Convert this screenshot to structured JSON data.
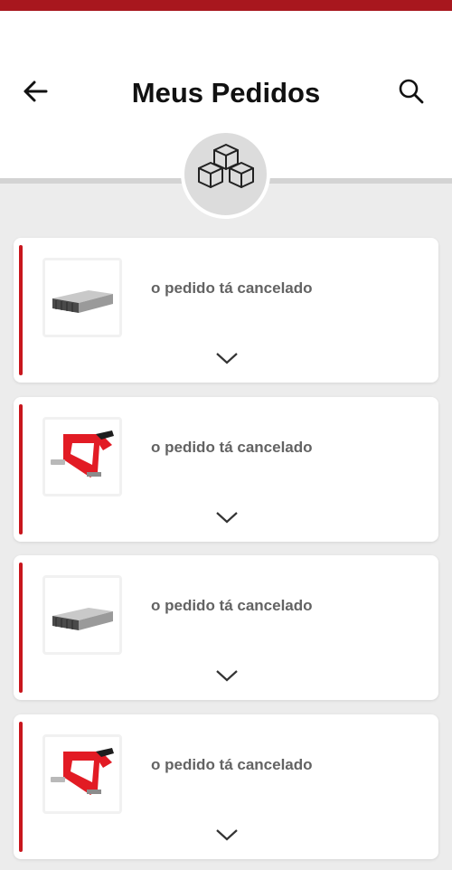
{
  "header": {
    "title": "Meus Pedidos",
    "back_icon": "arrow-left-icon",
    "search_icon": "search-icon",
    "badge_icon": "boxes-icon"
  },
  "colors": {
    "brand_red": "#a8171e",
    "accent_red": "#c8161d",
    "background": "#ececec",
    "status_text": "#636363"
  },
  "orders": [
    {
      "status": "o pedido tá cancelado",
      "product_icon": "staples-icon"
    },
    {
      "status": "o pedido tá cancelado",
      "product_icon": "staple-gun-icon"
    },
    {
      "status": "o pedido tá cancelado",
      "product_icon": "staples-icon"
    },
    {
      "status": "o pedido tá cancelado",
      "product_icon": "staple-gun-icon"
    }
  ]
}
